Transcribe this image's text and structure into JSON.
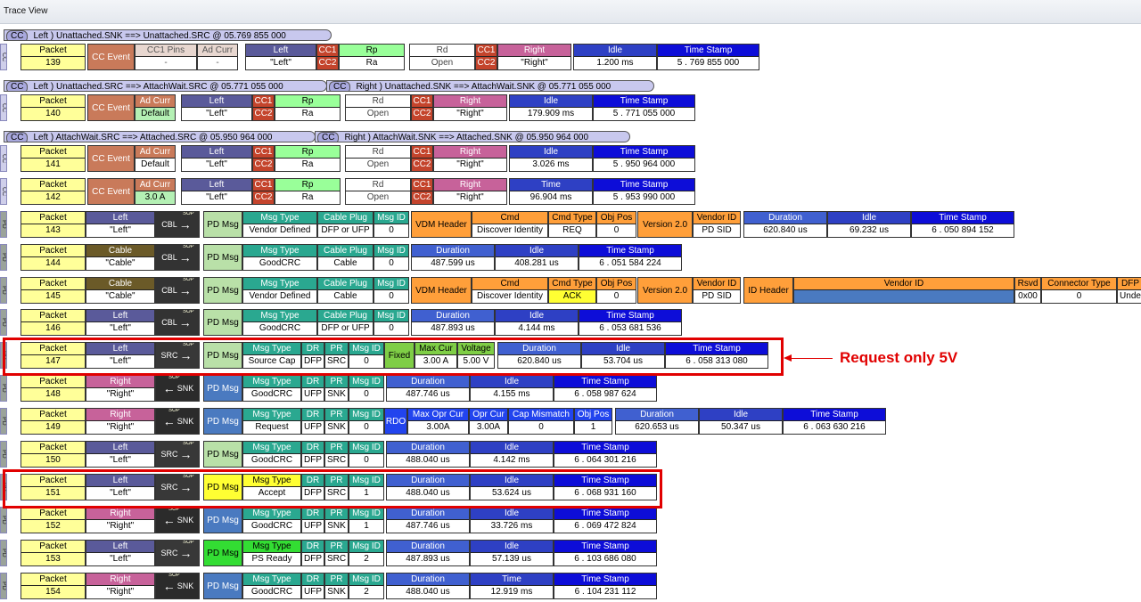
{
  "window": {
    "title": "Trace View"
  },
  "colors": {
    "packet_head": "#ffff99",
    "packet_val": "#ffffff",
    "cc_event": "#c97a5a",
    "left": "#5a5a9a",
    "right": "#c7629a",
    "cable": "#6b5a28",
    "cc_pin": "#c4442c",
    "rp": "#99ff99",
    "idle": "#2e40c4",
    "time": "#0d0dd8",
    "duration": "#4060d0",
    "msgtype": "#2aa890",
    "pdmsg": "#b9e0a8",
    "vdm": "#ff9f3a",
    "fixed": "#7fce46",
    "rdo": "#2244ee",
    "highlight": "#e10000"
  },
  "annotation": {
    "label": "Request only 5V"
  },
  "banners": [
    {
      "cc": "CC",
      "text": "Left ) Unattached.SNK ==> Unattached.SRC @ 05.769 855 000"
    },
    {
      "cc": "CC",
      "text": "Left ) Unattached.SRC ==> AttachWait.SRC @ 05.771 055 000"
    },
    {
      "cc": "CC",
      "text": "Right ) Unattached.SNK ==> AttachWait.SNK @ 05.771 055 000"
    },
    {
      "cc": "CC",
      "text": "Left ) AttachWait.SRC ==> Attached.SRC @ 05.950 964 000"
    },
    {
      "cc": "CC",
      "text": "Right ) AttachWait.SNK ==> Attached.SNK @ 05.950 964 000"
    }
  ],
  "packets": [
    {
      "rail": "CC",
      "packet": "139",
      "event": "CC Event",
      "f1": [
        "CC1 Pins",
        "-"
      ],
      "f2": [
        "Ad Curr",
        "-"
      ],
      "left": [
        "Left",
        "\"Left\""
      ],
      "ccA": [
        "CC1",
        "CC2"
      ],
      "lval": [
        "Rp",
        "Ra"
      ],
      "rval": [
        "Rd",
        "Open"
      ],
      "ccB": [
        "CC1",
        "CC2"
      ],
      "right": [
        "Right",
        "\"Right\""
      ],
      "t1": [
        "Idle",
        "1.200 ms"
      ],
      "t2": [
        "Time Stamp",
        "5 . 769 855 000"
      ]
    },
    {
      "rail": "CC",
      "packet": "140",
      "event": "CC Event",
      "f2": [
        "Ad Curr",
        "Default"
      ],
      "left": [
        "Left",
        "\"Left\""
      ],
      "ccA": [
        "CC1",
        "CC2"
      ],
      "lval": [
        "Rp",
        "Ra"
      ],
      "rval": [
        "Rd",
        "Open"
      ],
      "ccB": [
        "CC1",
        "CC2"
      ],
      "right": [
        "Right",
        "\"Right\""
      ],
      "t1": [
        "Idle",
        "179.909 ms"
      ],
      "t2": [
        "Time Stamp",
        "5 . 771 055 000"
      ]
    },
    {
      "rail": "CC",
      "packet": "141",
      "event": "CC Event",
      "f2": [
        "Ad Curr",
        "Default"
      ],
      "left": [
        "Left",
        "\"Left\""
      ],
      "ccA": [
        "CC1",
        "CC2"
      ],
      "lval": [
        "Rp",
        "Ra"
      ],
      "rval": [
        "Rd",
        "Open"
      ],
      "ccB": [
        "CC1",
        "CC2"
      ],
      "right": [
        "Right",
        "\"Right\""
      ],
      "t1": [
        "Idle",
        "3.026 ms"
      ],
      "t2": [
        "Time Stamp",
        "5 . 950 964 000"
      ]
    },
    {
      "rail": "CC",
      "packet": "142",
      "event": "CC Event",
      "f2": [
        "Ad Curr",
        "3.0 A"
      ],
      "left": [
        "Left",
        "\"Left\""
      ],
      "ccA": [
        "CC1",
        "CC2"
      ],
      "lval": [
        "Rp",
        "Ra"
      ],
      "rval": [
        "Rd",
        "Open"
      ],
      "ccB": [
        "CC1",
        "CC2"
      ],
      "right": [
        "Right",
        "\"Right\""
      ],
      "t1": [
        "Time",
        "96.904 ms"
      ],
      "t2": [
        "Time Stamp",
        "5 . 953 990 000"
      ]
    },
    {
      "rail": "PD",
      "packet": "143",
      "src": [
        "Left",
        "\"Left\""
      ],
      "dir": "CBL",
      "pd": "PD Msg",
      "msg": [
        "Msg Type",
        "Vendor Defined"
      ],
      "plug": [
        "Cable Plug",
        "DFP or UFP"
      ],
      "msgid": [
        "Msg ID",
        "0"
      ],
      "vdm": "VDM Header",
      "cmd": [
        "Cmd",
        "Discover Identity"
      ],
      "cmdtype": [
        "Cmd Type",
        "REQ"
      ],
      "objpos": [
        "Obj Pos",
        "0"
      ],
      "ver": "Version 2.0",
      "vid": [
        "Vendor ID",
        "PD SID"
      ],
      "t0": [
        "Duration",
        "620.840 us"
      ],
      "t1": [
        "Idle",
        "69.232 us"
      ],
      "t2": [
        "Time Stamp",
        "6 . 050 894 152"
      ]
    },
    {
      "rail": "PD",
      "packet": "144",
      "src": [
        "Cable",
        "\"Cable\""
      ],
      "dir": "CBL",
      "pd": "PD Msg",
      "msg": [
        "Msg Type",
        "GoodCRC"
      ],
      "plug": [
        "Cable Plug",
        "Cable"
      ],
      "msgid": [
        "Msg ID",
        "0"
      ],
      "t0": [
        "Duration",
        "487.599 us"
      ],
      "t1": [
        "Idle",
        "408.281 us"
      ],
      "t2": [
        "Time Stamp",
        "6 . 051 584 224"
      ]
    },
    {
      "rail": "PD",
      "packet": "145",
      "src": [
        "Cable",
        "\"Cable\""
      ],
      "dir": "CBL",
      "pd": "PD Msg",
      "msg": [
        "Msg Type",
        "Vendor Defined"
      ],
      "plug": [
        "Cable Plug",
        "Cable"
      ],
      "msgid": [
        "Msg ID",
        "0"
      ],
      "vdm": "VDM Header",
      "cmd": [
        "Cmd",
        "Discover Identity"
      ],
      "cmdtype": [
        "Cmd Type",
        "ACK"
      ],
      "objpos": [
        "Obj Pos",
        "0"
      ],
      "ver": "Version 2.0",
      "vid": [
        "Vendor ID",
        "PD SID"
      ],
      "idh": "ID Header",
      "vendorid": [
        "Vendor ID",
        ""
      ],
      "rsvd": [
        "Rsvd",
        "0x00"
      ],
      "conn": [
        "Connector Type",
        "0"
      ],
      "dfp": [
        "DFP",
        "Unde"
      ]
    },
    {
      "rail": "PD",
      "packet": "146",
      "src": [
        "Left",
        "\"Left\""
      ],
      "dir": "CBL",
      "pd": "PD Msg",
      "msg": [
        "Msg Type",
        "GoodCRC"
      ],
      "plug": [
        "Cable Plug",
        "DFP or UFP"
      ],
      "msgid": [
        "Msg ID",
        "0"
      ],
      "t0": [
        "Duration",
        "487.893 us"
      ],
      "t1": [
        "Idle",
        "4.144 ms"
      ],
      "t2": [
        "Time Stamp",
        "6 . 053 681 536"
      ]
    },
    {
      "rail": "PD",
      "packet": "147",
      "src": [
        "Left",
        "\"Left\""
      ],
      "dir": "SRC",
      "pd": "PD Msg",
      "msg": [
        "Msg Type",
        "Source Cap"
      ],
      "dr": [
        "DR",
        "DFP"
      ],
      "pr": [
        "PR",
        "SRC"
      ],
      "msgid": [
        "Msg ID",
        "0"
      ],
      "fixed": "Fixed",
      "maxcur": [
        "Max Cur",
        "3.00 A"
      ],
      "volt": [
        "Voltage",
        "5.00 V"
      ],
      "t0": [
        "Duration",
        "620.840 us"
      ],
      "t1": [
        "Idle",
        "53.704 us"
      ],
      "t2": [
        "Time Stamp",
        "6 . 058 313 080"
      ]
    },
    {
      "rail": "PD",
      "packet": "148",
      "src": [
        "Right",
        "\"Right\""
      ],
      "dir": "SNK",
      "pd": "PD Msg",
      "msg": [
        "Msg Type",
        "GoodCRC"
      ],
      "dr": [
        "DR",
        "UFP"
      ],
      "pr": [
        "PR",
        "SNK"
      ],
      "msgid": [
        "Msg ID",
        "0"
      ],
      "t0": [
        "Duration",
        "487.746 us"
      ],
      "t1": [
        "Idle",
        "4.155 ms"
      ],
      "t2": [
        "Time Stamp",
        "6 . 058 987 624"
      ]
    },
    {
      "rail": "PD",
      "packet": "149",
      "src": [
        "Right",
        "\"Right\""
      ],
      "dir": "SNK",
      "pd": "PD Msg",
      "msg": [
        "Msg Type",
        "Request"
      ],
      "dr": [
        "DR",
        "UFP"
      ],
      "pr": [
        "PR",
        "SNK"
      ],
      "msgid": [
        "Msg ID",
        "0"
      ],
      "rdo": "RDO",
      "maxopr": [
        "Max Opr Cur",
        "3.00A"
      ],
      "oprcur": [
        "Opr Cur",
        "3.00A"
      ],
      "capmis": [
        "Cap Mismatch",
        "0"
      ],
      "objpos": [
        "Obj Pos",
        "1"
      ],
      "t0": [
        "Duration",
        "620.653 us"
      ],
      "t1": [
        "Idle",
        "50.347 us"
      ],
      "t2": [
        "Time Stamp",
        "6 . 063 630 216"
      ]
    },
    {
      "rail": "PD",
      "packet": "150",
      "src": [
        "Left",
        "\"Left\""
      ],
      "dir": "SRC",
      "pd": "PD Msg",
      "msg": [
        "Msg Type",
        "GoodCRC"
      ],
      "dr": [
        "DR",
        "DFP"
      ],
      "pr": [
        "PR",
        "SRC"
      ],
      "msgid": [
        "Msg ID",
        "0"
      ],
      "t0": [
        "Duration",
        "488.040 us"
      ],
      "t1": [
        "Idle",
        "4.142 ms"
      ],
      "t2": [
        "Time Stamp",
        "6 . 064 301 216"
      ]
    },
    {
      "rail": "PD",
      "packet": "151",
      "src": [
        "Left",
        "\"Left\""
      ],
      "dir": "SRC",
      "pd": "PD Msg",
      "msg": [
        "Msg Type",
        "Accept"
      ],
      "dr": [
        "DR",
        "DFP"
      ],
      "pr": [
        "PR",
        "SRC"
      ],
      "msgid": [
        "Msg ID",
        "1"
      ],
      "t0": [
        "Duration",
        "488.040 us"
      ],
      "t1": [
        "Idle",
        "53.624 us"
      ],
      "t2": [
        "Time Stamp",
        "6 . 068 931 160"
      ]
    },
    {
      "rail": "PD",
      "packet": "152",
      "src": [
        "Right",
        "\"Right\""
      ],
      "dir": "SNK",
      "pd": "PD Msg",
      "msg": [
        "Msg Type",
        "GoodCRC"
      ],
      "dr": [
        "DR",
        "UFP"
      ],
      "pr": [
        "PR",
        "SNK"
      ],
      "msgid": [
        "Msg ID",
        "1"
      ],
      "t0": [
        "Duration",
        "487.746 us"
      ],
      "t1": [
        "Idle",
        "33.726 ms"
      ],
      "t2": [
        "Time Stamp",
        "6 . 069 472 824"
      ]
    },
    {
      "rail": "PD",
      "packet": "153",
      "src": [
        "Left",
        "\"Left\""
      ],
      "dir": "SRC",
      "pd": "PD Msg",
      "msg": [
        "Msg Type",
        "PS Ready"
      ],
      "dr": [
        "DR",
        "DFP"
      ],
      "pr": [
        "PR",
        "SRC"
      ],
      "msgid": [
        "Msg ID",
        "2"
      ],
      "t0": [
        "Duration",
        "487.893 us"
      ],
      "t1": [
        "Idle",
        "57.139 us"
      ],
      "t2": [
        "Time Stamp",
        "6 . 103 686 080"
      ]
    },
    {
      "rail": "PD",
      "packet": "154",
      "src": [
        "Right",
        "\"Right\""
      ],
      "dir": "SNK",
      "pd": "PD Msg",
      "msg": [
        "Msg Type",
        "GoodCRC"
      ],
      "dr": [
        "DR",
        "UFP"
      ],
      "pr": [
        "PR",
        "SNK"
      ],
      "msgid": [
        "Msg ID",
        "2"
      ],
      "t0": [
        "Duration",
        "488.040 us"
      ],
      "t1": [
        "Time",
        "12.919 ms"
      ],
      "t2": [
        "Time Stamp",
        "6 . 104 231 112"
      ]
    }
  ]
}
